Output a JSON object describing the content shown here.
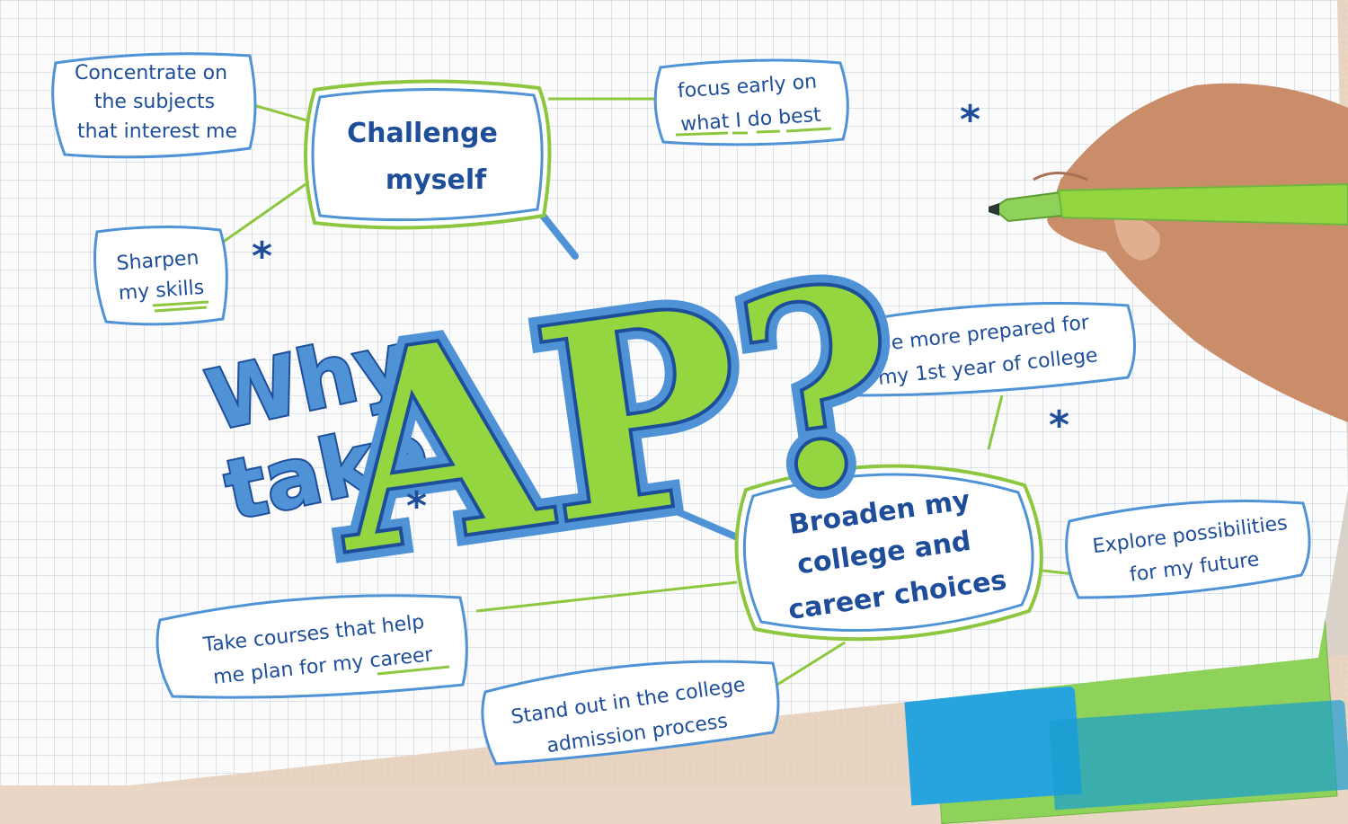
{
  "central_title": {
    "line1": "Why",
    "line2": "take",
    "big": "AP?"
  },
  "hubs": {
    "challenge": {
      "line1": "Challenge",
      "line2": "myself"
    },
    "broaden": {
      "line1": "Broaden my",
      "line2": "college and",
      "line3": "career choices"
    }
  },
  "notes": {
    "concentrate": {
      "line1": "Concentrate on",
      "line2": "the subjects",
      "line3": "that interest me"
    },
    "focus": {
      "line1": "focus early on",
      "line2": "what I do best"
    },
    "sharpen": {
      "line1": "Sharpen",
      "line2": "my skills"
    },
    "prepared": {
      "line1": "Be more prepared for",
      "line2": "my 1st year of college"
    },
    "explore": {
      "line1": "Explore possibilities",
      "line2": "for my future"
    },
    "courses": {
      "line1": "Take courses that help",
      "line2": "me plan for my career"
    },
    "stand_out": {
      "line1": "Stand out in the college",
      "line2": "admission process"
    }
  },
  "colors": {
    "ink_blue": "#1e4e9a",
    "light_blue": "#4f93d6",
    "green": "#8dc63f",
    "marker_green": "#93d63f"
  },
  "icons": [
    "asterisk-icon",
    "marker-pen",
    "hand"
  ]
}
